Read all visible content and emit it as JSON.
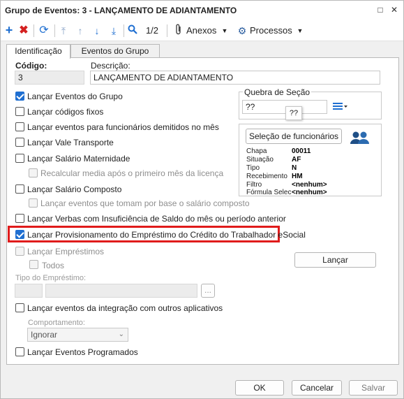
{
  "window": {
    "title": "Grupo de Eventos: 3 - LANÇAMENTO DE ADIANTAMENTO",
    "restore_glyph": "□",
    "close_glyph": "✕"
  },
  "toolbar": {
    "page_indicator": "1/2",
    "anexos_label": "Anexos",
    "processos_label": "Processos"
  },
  "tabs": [
    {
      "label": "Identificação",
      "active": true
    },
    {
      "label": "Eventos do Grupo",
      "active": false
    }
  ],
  "form": {
    "codigo_label": "Código:",
    "codigo_value": "3",
    "descricao_label": "Descrição:",
    "descricao_value": "LANÇAMENTO DE ADIANTAMENTO"
  },
  "options": {
    "lancar_eventos_grupo": "Lançar Eventos do Grupo",
    "lancar_codigos_fixos": "Lançar códigos fixos",
    "lancar_eventos_demitidos": "Lançar eventos para funcionários demitidos no mês",
    "lancar_vale_transporte": "Lançar Vale Transporte",
    "lancar_salario_maternidade": "Lançar Salário Maternidade",
    "recalcular_media": "Recalcular media após o primeiro mês da licença",
    "lancar_salario_composto": "Lançar Salário Composto",
    "lancar_eventos_composto": "Lançar eventos que tomam por base o salário composto",
    "lancar_verbas_insuficiencia": "Lançar Verbas com Insuficiência de Saldo do mês ou período anterior",
    "lancar_provisionamento": "Lançar Provisionamento do Empréstimo do Crédito do Trabalhador eSocial",
    "lancar_emprestimos": "Lançar Empréstimos",
    "todos": "Todos",
    "tipo_emprestimo_label": "Tipo do Empréstimo:",
    "ellipsis": "...",
    "lancar_integracao": "Lançar eventos da integração com outros aplicativos",
    "comportamento_label": "Comportamento:",
    "comportamento_value": "Ignorar",
    "lancar_programados": "Lançar Eventos Programados"
  },
  "quebra": {
    "label": "Quebra de Seção",
    "value": "??",
    "tooltip": "??"
  },
  "selecao": {
    "button_label": "Seleção de funcionários",
    "rows": [
      {
        "key": "Chapa",
        "value": "00011"
      },
      {
        "key": "Situação",
        "value": "AF"
      },
      {
        "key": "Tipo",
        "value": "N"
      },
      {
        "key": "Recebimento",
        "value": "HM"
      },
      {
        "key": "Filtro",
        "value": "<nenhum>"
      },
      {
        "key": "Fórmula Selec",
        "value": "<nenhum>"
      }
    ]
  },
  "lancar_button": "Lançar",
  "footer": {
    "ok": "OK",
    "cancelar": "Cancelar",
    "salvar": "Salvar"
  },
  "colors": {
    "accent_blue": "#1f6fd1",
    "highlight_red": "#e01b1b",
    "delete_red": "#d42020"
  }
}
